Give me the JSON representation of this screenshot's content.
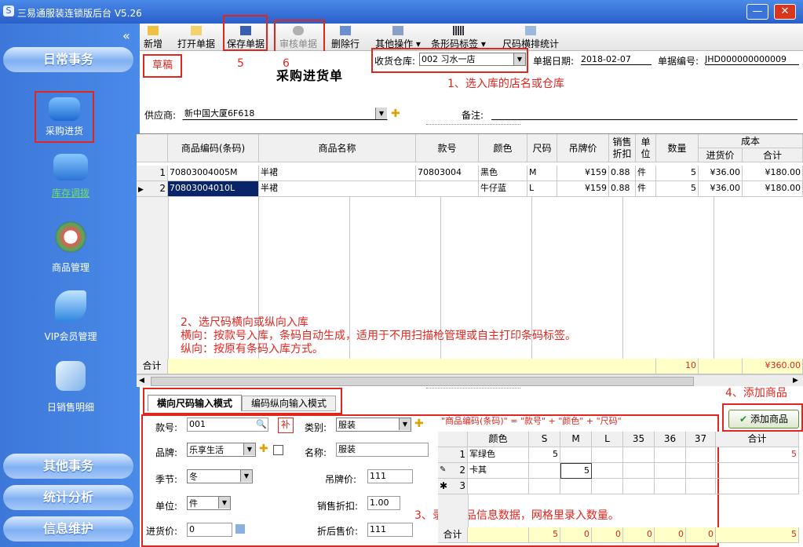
{
  "window": {
    "title": "三易通服装连锁版后台  V5.26"
  },
  "sidebar": {
    "collapse_glyph": "«",
    "top_pill": "日常事务",
    "items": [
      {
        "label": "采购进货",
        "icon": "purchase-house-icon"
      },
      {
        "label": "库存调拨",
        "icon": "transfer-houses-icon"
      },
      {
        "label": "商品管理",
        "icon": "magnifier-goods-icon"
      },
      {
        "label": "VIP会员管理",
        "icon": "vip-leaf-icon"
      },
      {
        "label": "日销售明细",
        "icon": "sales-detail-icon"
      }
    ],
    "bottom_pills": [
      "其他事务",
      "统计分析",
      "信息维护"
    ]
  },
  "toolbar": {
    "buttons": [
      {
        "label": "新增",
        "icon": "new-icon"
      },
      {
        "label": "打开单据",
        "icon": "open-folder-icon"
      },
      {
        "label": "保存单据",
        "icon": "save-disk-icon"
      },
      {
        "label": "审核单据",
        "icon": "approve-check-icon"
      },
      {
        "label": "删除行",
        "icon": "delete-row-icon"
      },
      {
        "label": "其他操作",
        "icon": "other-ops-icon"
      },
      {
        "label": "条形码标签",
        "icon": "barcode-icon"
      },
      {
        "label": "尺码横排统计",
        "icon": "size-table-icon"
      }
    ],
    "annot_save": "5",
    "annot_approve": "6"
  },
  "header": {
    "status_stamp": "草稿",
    "title": "采购进货单",
    "warehouse_label": "收货仓库:",
    "warehouse_value": "002 习水一店",
    "date_label": "单据日期:",
    "date_value": "2018-02-07",
    "docno_label": "单据编号:",
    "docno_value": "JHD000000000009",
    "annot_1": "1、选入库的店名或仓库",
    "supplier_label": "供应商:",
    "supplier_value": "新中国大厦6F618",
    "remark_label": "备注:"
  },
  "grid": {
    "columns": [
      "商品编码(条码)",
      "商品名称",
      "款号",
      "颜色",
      "尺码",
      "吊牌价",
      "销售折扣",
      "单位",
      "数量",
      "成本",
      "进货价",
      "合计"
    ],
    "rows": [
      {
        "no": "1",
        "code": "70803004005M",
        "name": "半裙",
        "style": "70803004",
        "color": "黑色",
        "size": "M",
        "tag_price": "¥159",
        "discount": "0.88",
        "unit": "件",
        "qty": "5",
        "cost": "¥36.00",
        "total": "¥180.00"
      },
      {
        "no": "2",
        "code": "70803004010L",
        "name": "半裙",
        "style": "",
        "color": "牛仔蓝",
        "size": "L",
        "tag_price": "¥159",
        "discount": "0.88",
        "unit": "件",
        "qty": "5",
        "cost": "¥36.00",
        "total": "¥180.00"
      }
    ],
    "footer": {
      "label": "合计",
      "qty": "10",
      "total": "¥360.00"
    },
    "annot_2_line1": "2、选尺码横向或纵向入库",
    "annot_2_line2": "横向：按款号入库，条码自动生成，适用于不用扫描枪管理或自主打印条码标签。",
    "annot_2_line3": "纵向：按原有条码入库方式。"
  },
  "entry": {
    "tabs": [
      "横向尺码输入模式",
      "编码纵向输入模式"
    ],
    "annot_4": "4、添加商品",
    "formula": "\"商品编码(条码)\" = \"款号\" + \"颜色\" + \"尺码\"",
    "add_button": "添加商品",
    "style_label": "款号:",
    "style_value": "001",
    "fill_btn": "补",
    "category_label": "类别:",
    "category_value": "服装",
    "brand_label": "品牌:",
    "brand_value": "乐享生活",
    "name_label": "名称:",
    "name_value": "服装",
    "season_label": "季节:",
    "season_value": "冬",
    "tag_label": "吊牌价:",
    "tag_value": "111",
    "unit_label": "单位:",
    "unit_value": "件",
    "disc_label": "销售折扣:",
    "disc_value": "1.00",
    "cost_label": "进货价:",
    "cost_value": "0",
    "final_label": "折后售价:",
    "final_value": "111",
    "annot_3": "3、录入商品信息数据，网格里录入数量。",
    "size_grid": {
      "columns": [
        "颜色",
        "S",
        "M",
        "L",
        "35",
        "36",
        "37",
        "合计"
      ],
      "rows": [
        {
          "marker": "1",
          "color": "军绿色",
          "S": "5",
          "M": "",
          "L": "",
          "35": "",
          "36": "",
          "37": "",
          "total": "5"
        },
        {
          "marker": "2",
          "color": "卡其",
          "S": "",
          "M": "5",
          "L": "",
          "35": "",
          "36": "",
          "37": "",
          "total": ""
        },
        {
          "marker": "3",
          "color": "",
          "S": "",
          "M": "",
          "L": "",
          "35": "",
          "36": "",
          "37": "",
          "total": ""
        }
      ],
      "footer": {
        "label": "合计",
        "S": "5",
        "M": "0",
        "L": "0",
        "35": "0",
        "36": "0",
        "37": "0",
        "total": "5"
      }
    }
  },
  "colors": {
    "annotation_red": "#e0261f",
    "footer_yellow": "#ffffc8",
    "selection_blue": "#0a246a"
  }
}
